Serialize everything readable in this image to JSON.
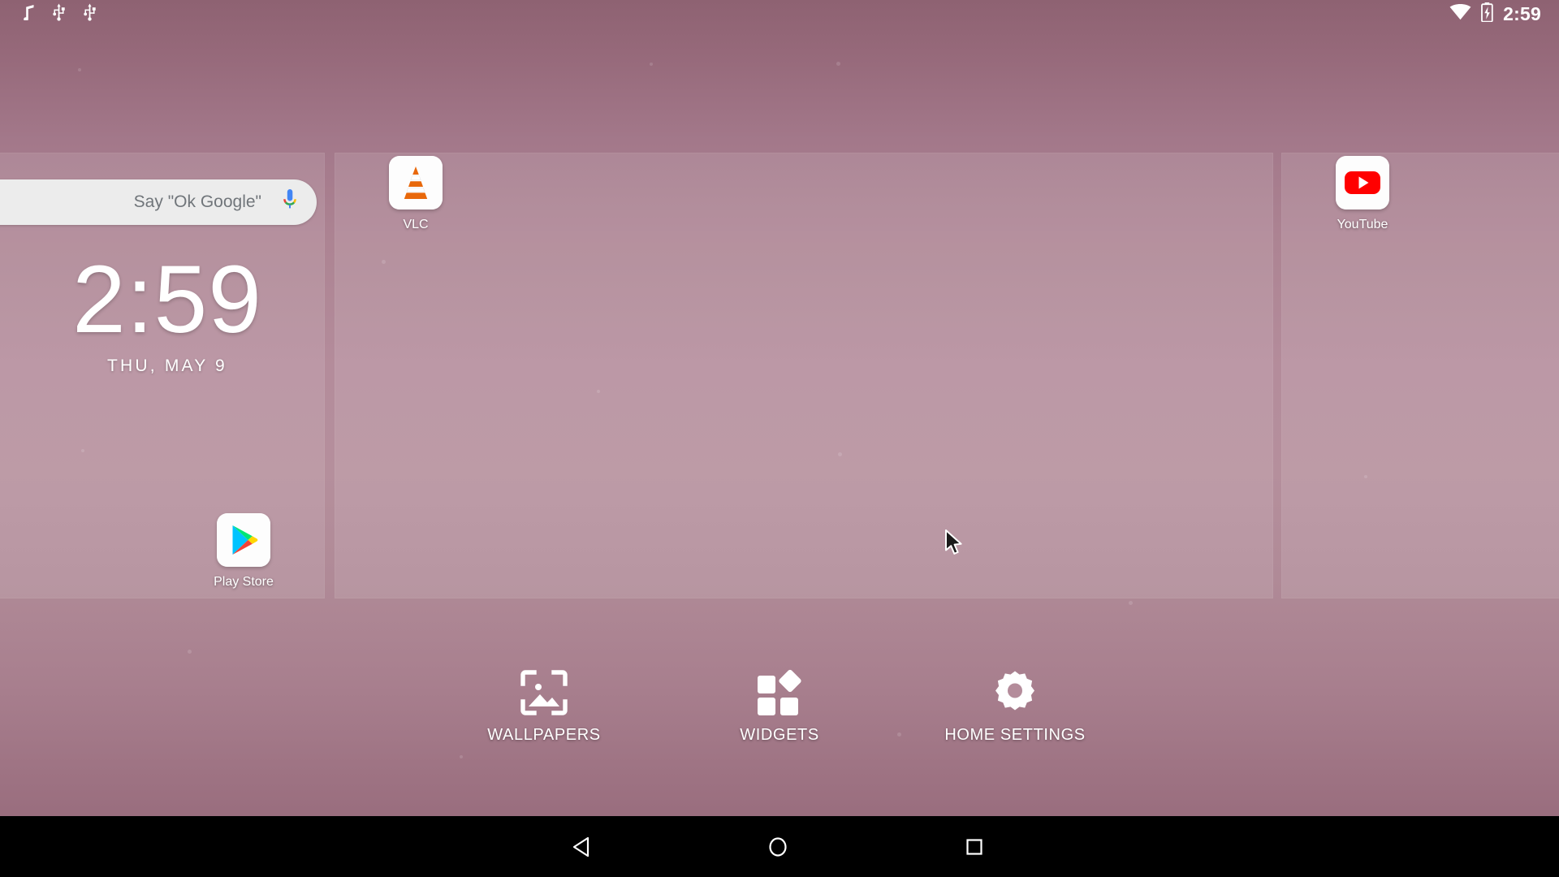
{
  "status_bar": {
    "left_icons": [
      {
        "name": "music-note-icon",
        "label": "music"
      },
      {
        "name": "usb-icon",
        "label": "usb"
      },
      {
        "name": "usb-icon-2",
        "label": "usb"
      }
    ],
    "right_icons": [
      {
        "name": "wifi-icon",
        "label": "wifi"
      },
      {
        "name": "battery-charging-icon",
        "label": "battery charging"
      }
    ],
    "clock": "2:59"
  },
  "search": {
    "placeholder": "Say \"Ok Google\"",
    "mic_icon": "microphone-icon"
  },
  "clock_widget": {
    "time": "2:59",
    "date": "THU, MAY 9"
  },
  "apps": [
    {
      "id": "vlc",
      "label": "VLC",
      "icon": "vlc-icon"
    },
    {
      "id": "youtube",
      "label": "YouTube",
      "icon": "youtube-icon"
    },
    {
      "id": "playstore",
      "label": "Play Store",
      "icon": "play-store-icon"
    }
  ],
  "action_bar": [
    {
      "id": "wallpapers",
      "label": "WALLPAPERS",
      "icon": "wallpaper-image-icon"
    },
    {
      "id": "widgets",
      "label": "WIDGETS",
      "icon": "widgets-grid-icon"
    },
    {
      "id": "home-settings",
      "label": "HOME SETTINGS",
      "icon": "gear-icon"
    }
  ],
  "nav_bar": [
    {
      "id": "back",
      "label": "Back",
      "icon": "triangle-back-icon"
    },
    {
      "id": "home",
      "label": "Home",
      "icon": "circle-home-icon"
    },
    {
      "id": "recents",
      "label": "Recents",
      "icon": "square-recents-icon"
    }
  ],
  "colors": {
    "wallpaper_top": "#8e6272",
    "wallpaper_mid": "#b58f9c",
    "panel_overlay": "rgba(255,255,255,0.11)",
    "search_bar": "#ececec",
    "nav_bar": "#000000",
    "accent_white": "#ffffff",
    "youtube_red": "#ff0000",
    "vlc_orange": "#f57c00"
  }
}
